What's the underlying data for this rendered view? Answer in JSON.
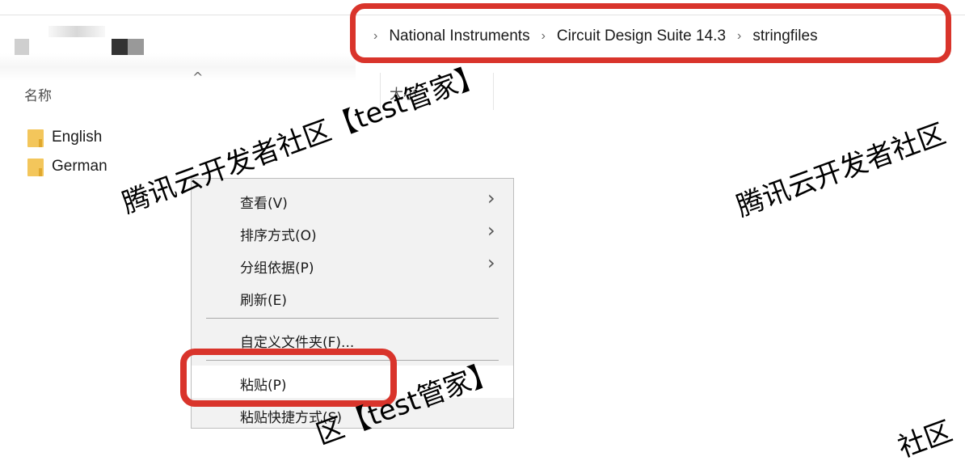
{
  "breadcrumb": {
    "items": [
      "National Instruments",
      "Circuit Design Suite 14.3",
      "stringfiles"
    ]
  },
  "columns": {
    "name": "名称",
    "size": "大小"
  },
  "files": [
    {
      "name": "English",
      "icon": "folder-icon"
    },
    {
      "name": "German",
      "icon": "folder-icon"
    }
  ],
  "context_menu": {
    "view": "查看(V)",
    "sort_by": "排序方式(O)",
    "group_by": "分组依据(P)",
    "refresh": "刷新(E)",
    "customize_folder": "自定义文件夹(F)...",
    "paste": "粘贴(P)",
    "paste_shortcut": "粘贴快捷方式(S)"
  },
  "watermarks": [
    "腾讯云开发者社区【test管家】",
    "腾讯云开发者社区",
    "区【test管家】",
    "社区"
  ],
  "colors": {
    "highlight_red": "#d9342b",
    "folder_yellow": "#f3c65b",
    "menu_bg": "#f2f2f2"
  }
}
